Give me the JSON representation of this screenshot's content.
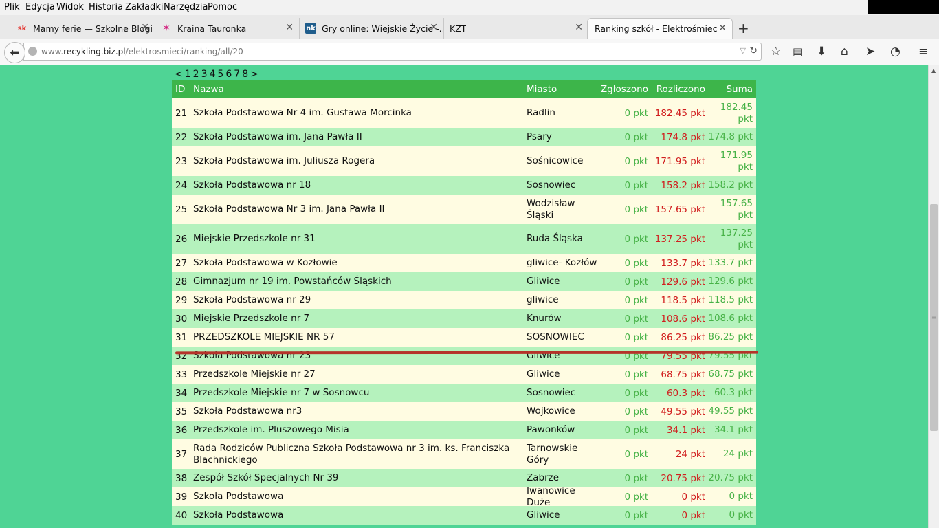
{
  "menu": [
    "Plik",
    "Edycja",
    "Widok",
    "Historia",
    "Zakładki",
    "Narzędzia",
    "Pomoc"
  ],
  "tabs": [
    {
      "title": "Mamy ferie — Szkolne Blogi",
      "favicon": "sk"
    },
    {
      "title": "Kraina Tauronka",
      "favicon": "tauron-icon"
    },
    {
      "title": "Gry online: Wiejskie Życie -...",
      "favicon": "nk"
    },
    {
      "title": "KZT",
      "favicon": ""
    },
    {
      "title": "Ranking szkół - Elektrośmieci o...",
      "favicon": ""
    }
  ],
  "address": {
    "prefix": "www.",
    "domain": "recykling.biz.pl",
    "path": "/elektrosmieci/ranking/all/20"
  },
  "pager": [
    "<",
    "1",
    "2",
    "3",
    "4",
    "5",
    "6",
    "7",
    "8",
    ">"
  ],
  "table": {
    "headers": {
      "id": "ID",
      "name": "Nazwa",
      "city": "Miasto",
      "reported": "Zgłoszono",
      "settled": "Rozliczono",
      "sum": "Suma"
    },
    "rows": [
      {
        "id": "21",
        "name": "Szkoła Podstawowa Nr 4 im. Gustawa Morcinka",
        "city": "Radlin",
        "reported": "0 pkt",
        "settled": "182.45 pkt",
        "sum": "182.45 pkt"
      },
      {
        "id": "22",
        "name": "Szkoła Podstawowa im. Jana Pawła II",
        "city": "Psary",
        "reported": "0 pkt",
        "settled": "174.8 pkt",
        "sum": "174.8 pkt"
      },
      {
        "id": "23",
        "name": "Szkoła Podstawowa im. Juliusza Rogera",
        "city": "Sośnicowice",
        "reported": "0 pkt",
        "settled": "171.95 pkt",
        "sum": "171.95 pkt"
      },
      {
        "id": "24",
        "name": "Szkoła Podstawowa nr 18",
        "city": "Sosnowiec",
        "reported": "0 pkt",
        "settled": "158.2 pkt",
        "sum": "158.2 pkt"
      },
      {
        "id": "25",
        "name": "Szkoła Podstawowa Nr 3 im. Jana Pawła II",
        "city": "Wodzisław Śląski",
        "reported": "0 pkt",
        "settled": "157.65 pkt",
        "sum": "157.65 pkt"
      },
      {
        "id": "26",
        "name": "Miejskie Przedszkole nr 31",
        "city": "Ruda Śląska",
        "reported": "0 pkt",
        "settled": "137.25 pkt",
        "sum": "137.25 pkt"
      },
      {
        "id": "27",
        "name": "Szkoła Podstawowa w Kozłowie",
        "city": "gliwice- Kozłów",
        "reported": "0 pkt",
        "settled": "133.7 pkt",
        "sum": "133.7 pkt"
      },
      {
        "id": "28",
        "name": "Gimnazjum nr 19 im. Powstańców Śląskich",
        "city": "Gliwice",
        "reported": "0 pkt",
        "settled": "129.6 pkt",
        "sum": "129.6 pkt"
      },
      {
        "id": "29",
        "name": "Szkoła Podstawowa nr 29",
        "city": "gliwice",
        "reported": "0 pkt",
        "settled": "118.5 pkt",
        "sum": "118.5 pkt"
      },
      {
        "id": "30",
        "name": "Miejskie Przedszkole nr 7",
        "city": "Knurów",
        "reported": "0 pkt",
        "settled": "108.6 pkt",
        "sum": "108.6 pkt"
      },
      {
        "id": "31",
        "name": "PRZEDSZKOLE MIEJSKIE NR 57",
        "city": "SOSNOWIEC",
        "reported": "0 pkt",
        "settled": "86.25 pkt",
        "sum": "86.25 pkt"
      },
      {
        "id": "32",
        "name": "Szkoła Podstawowa nr 23",
        "city": "Gliwice",
        "reported": "0 pkt",
        "settled": "79.55 pkt",
        "sum": "79.55 pkt"
      },
      {
        "id": "33",
        "name": "Przedszkole Miejskie nr 27",
        "city": "Gliwice",
        "reported": "0 pkt",
        "settled": "68.75 pkt",
        "sum": "68.75 pkt"
      },
      {
        "id": "34",
        "name": "Przedszkole Miejskie nr 7 w Sosnowcu",
        "city": "Sosnowiec",
        "reported": "0 pkt",
        "settled": "60.3 pkt",
        "sum": "60.3 pkt"
      },
      {
        "id": "35",
        "name": "Szkoła Podstawowa nr3",
        "city": "Wojkowice",
        "reported": "0 pkt",
        "settled": "49.55 pkt",
        "sum": "49.55 pkt"
      },
      {
        "id": "36",
        "name": "Przedszkole im. Pluszowego Misia",
        "city": "Pawonków",
        "reported": "0 pkt",
        "settled": "34.1 pkt",
        "sum": "34.1 pkt"
      },
      {
        "id": "37",
        "name": "Rada Rodziców Publiczna Szkoła Podstawowa nr 3 im. ks. Franciszka Blachnickiego",
        "city": "Tarnowskie Góry",
        "reported": "0 pkt",
        "settled": "24 pkt",
        "sum": "24 pkt"
      },
      {
        "id": "38",
        "name": "Zespół Szkół Specjalnych Nr 39",
        "city": "Zabrze",
        "reported": "0 pkt",
        "settled": "20.75 pkt",
        "sum": "20.75 pkt"
      },
      {
        "id": "39",
        "name": "Szkoła Podstawowa",
        "city": "Iwanowice Duże",
        "reported": "0 pkt",
        "settled": "0 pkt",
        "sum": "0 pkt"
      },
      {
        "id": "40",
        "name": "Szkoła Podstawowa",
        "city": "Gliwice",
        "reported": "0 pkt",
        "settled": "0 pkt",
        "sum": "0 pkt"
      }
    ]
  },
  "colors": {
    "page_bg": "#4fd495",
    "header_green": "#3db54a",
    "row_light": "#fffce2",
    "row_green": "#b5f2bd",
    "points_green": "#47b247",
    "points_red": "#d11e1e",
    "annotation_line": "#b5332a"
  }
}
